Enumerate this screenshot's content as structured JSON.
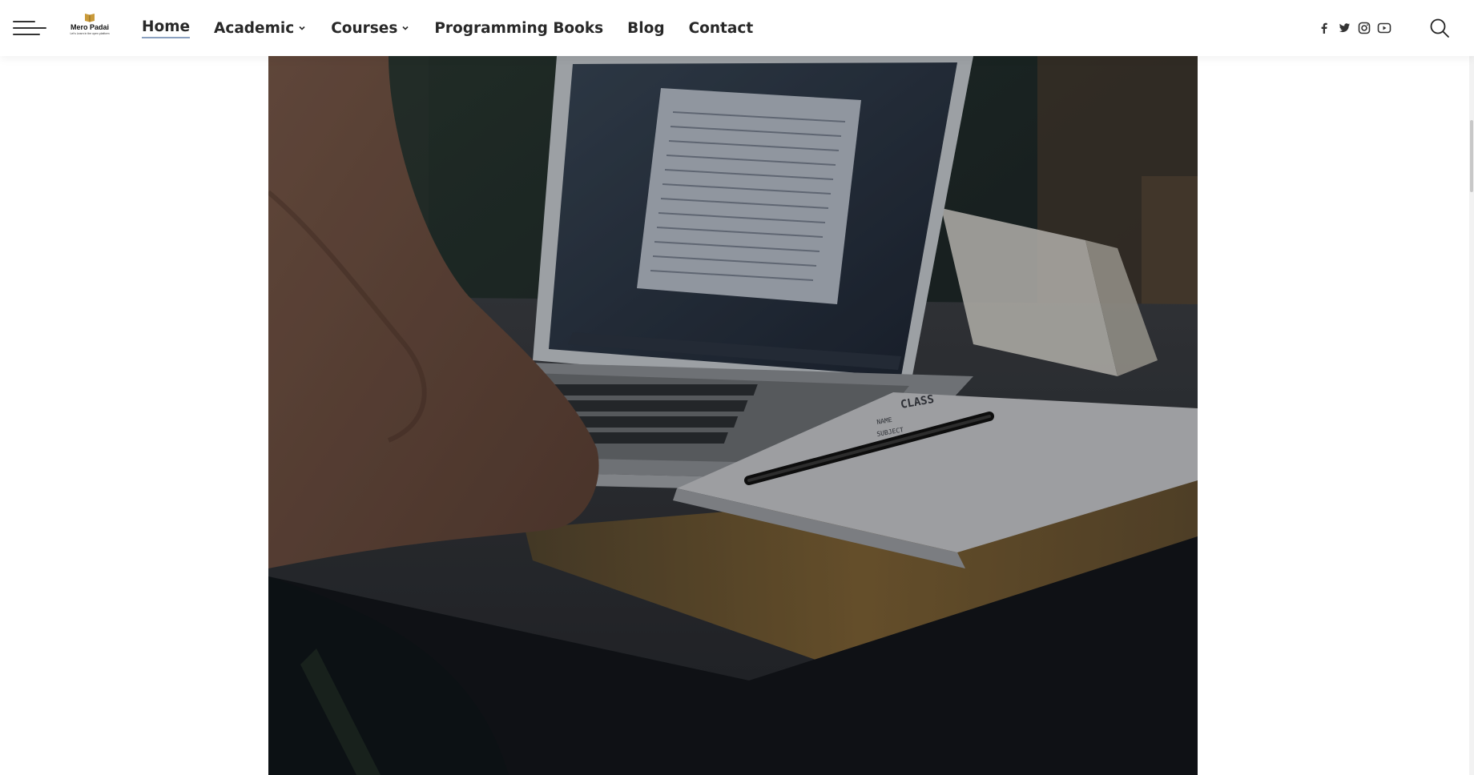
{
  "header": {
    "logo": {
      "name": "Mero Padai",
      "tagline": "Let's Learn in the open platform"
    },
    "nav": [
      {
        "label": "Home",
        "active": true,
        "dropdown": false
      },
      {
        "label": "Academic",
        "active": false,
        "dropdown": true
      },
      {
        "label": "Courses",
        "active": false,
        "dropdown": true
      },
      {
        "label": "Programming Books",
        "active": false,
        "dropdown": false
      },
      {
        "label": "Blog",
        "active": false,
        "dropdown": false
      },
      {
        "label": "Contact",
        "active": false,
        "dropdown": false
      }
    ],
    "socials": [
      "facebook-icon",
      "twitter-icon",
      "instagram-icon",
      "youtube-icon"
    ],
    "search_icon": "search-icon",
    "menu_icon": "hamburger-menu-icon"
  },
  "hero": {
    "image": "laptop-notebook-desk-photo",
    "notebook_text": [
      "CLASS",
      "NAME",
      "SUBJECT"
    ]
  },
  "colors": {
    "text": "#282828",
    "accent": "#8aa0c0",
    "overlay": "#1c1f25"
  }
}
